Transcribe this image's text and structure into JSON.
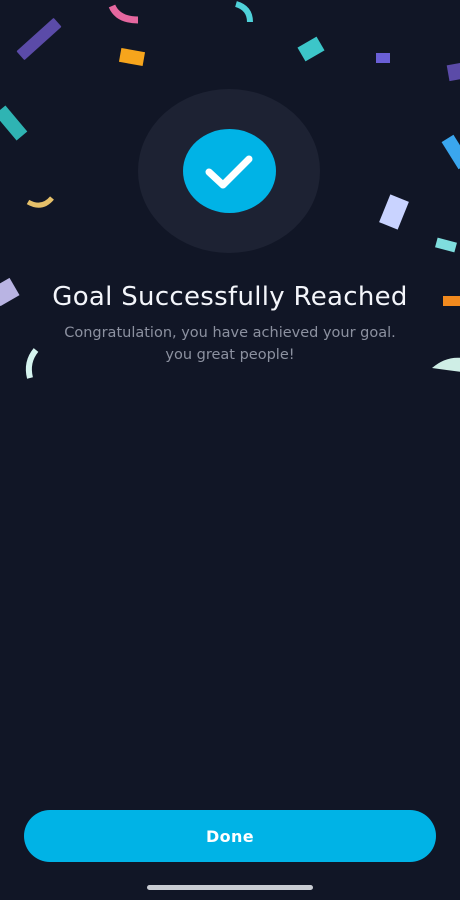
{
  "success": {
    "title": "Goal Successfully Reached",
    "message_line1": "Congratulation, you have achieved your goal.",
    "message_line2": "you great people!"
  },
  "actions": {
    "done_label": "Done"
  },
  "colors": {
    "background": "#111626",
    "accent": "#00b3e6",
    "badge_ring": "#1d2233",
    "title_text": "#f3f5fa",
    "subtitle_text": "#8c91a0"
  },
  "icons": {
    "badge": "checkmark-icon",
    "decoration": "confetti"
  }
}
